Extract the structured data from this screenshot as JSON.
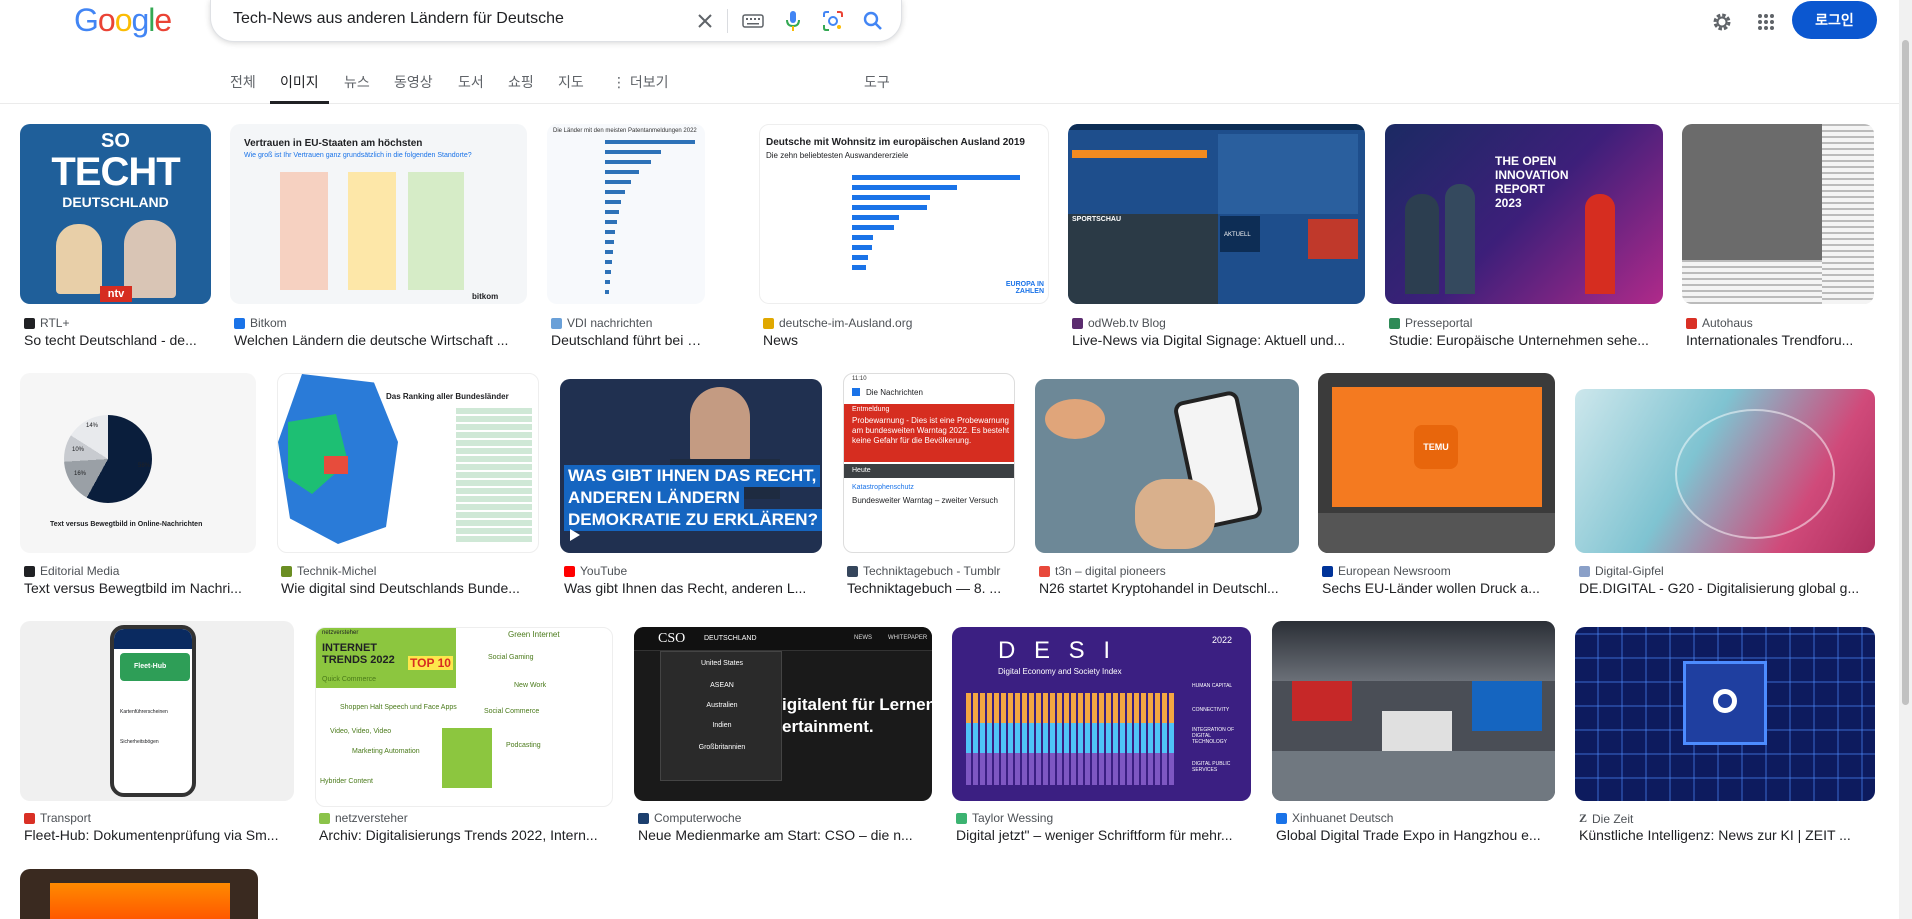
{
  "logo": {
    "letters": [
      "G",
      "o",
      "o",
      "g",
      "l",
      "e"
    ],
    "colors": [
      "#4285f4",
      "#ea4335",
      "#fbbc05",
      "#4285f4",
      "#34a853",
      "#ea4335"
    ]
  },
  "search": {
    "query": "Tech-News aus anderen Ländern für Deutsche"
  },
  "header": {
    "login_label": "로그인"
  },
  "tabs": [
    {
      "label": "전체"
    },
    {
      "label": "이미지"
    },
    {
      "label": "뉴스"
    },
    {
      "label": "동영상"
    },
    {
      "label": "도서"
    },
    {
      "label": "쇼핑"
    },
    {
      "label": "지도"
    },
    {
      "label": "⋮ 더보기"
    }
  ],
  "tools_label": "도구",
  "results": [
    {
      "source": "RTL+",
      "title": "So techt Deutschland - de...",
      "fav": "#202124",
      "thumb": {
        "bg": "#1f5f9a",
        "line1": "SO",
        "line2": "TECHT",
        "line3": "DEUTSCHLAND",
        "badge": "ntv"
      }
    },
    {
      "source": "Bitkom",
      "title": "Welchen Ländern die deutsche Wirtschaft ...",
      "fav": "#1a73e8",
      "thumb": {
        "heading": "Vertrauen in EU-Staaten am höchsten",
        "sub": "Wie groß ist Ihr Vertrauen ganz grundsätzlich in die folgenden Standorte?",
        "brand": "bitkom"
      }
    },
    {
      "source": "VDI nachrichten",
      "title": "Deutschland führt bei Pate...",
      "fav": "#6aa0d8",
      "thumb": {
        "heading": "Die Länder mit den meisten Patentanmeldungen 2022"
      }
    },
    {
      "source": "deutsche-im-Ausland.org",
      "title": "News",
      "fav": "#e0a800",
      "thumb": {
        "heading": "Deutsche mit Wohnsitz im europäischen Ausland 2019",
        "sub": "Die zehn beliebtesten Auswandererziele",
        "brand": "EUROPA IN ZAHLEN"
      }
    },
    {
      "source": "odWeb.tv Blog",
      "title": "Live-News via Digital Signage: Aktuell und...",
      "fav": "#5b2c6f",
      "thumb": {
        "label1": "SPORTSCHAU",
        "label2": "AKTUELL"
      }
    },
    {
      "source": "Presseportal",
      "title": "Studie: Europäische Unternehmen sehe...",
      "fav": "#2e8b57",
      "thumb": {
        "text": "THE OPEN INNOVATION REPORT 2023"
      }
    },
    {
      "source": "Autohaus",
      "title": "Internationales Trendforu...",
      "fav": "#d93025",
      "thumb": {}
    },
    {
      "source": "Editorial Media",
      "title": "Text versus Bewegtbild im Nachri...",
      "fav": "#202124",
      "thumb": {
        "caption": "Text versus Bewegtbild in Online-Nachrichten",
        "pcts": [
          "14%",
          "10%",
          "16%",
          "58%"
        ]
      }
    },
    {
      "source": "Technik-Michel",
      "title": "Wie digital sind Deutschlands Bunde...",
      "fav": "#6b8e23",
      "thumb": {
        "heading": "Das Ranking aller Bundesländer"
      }
    },
    {
      "source": "YouTube",
      "title": "Was gibt Ihnen das Recht, anderen L...",
      "fav": "#ff0000",
      "thumb": {
        "line1": "WAS GIBT IHNEN DAS RECHT,",
        "line2": "ANDEREN LÄNDERN",
        "line3": "DEMOKRATIE ZU ERKLÄREN?"
      }
    },
    {
      "source": "Techniktagebuch - Tumblr",
      "title": "Techniktagebuch — 8. ...",
      "fav": "#35465c",
      "thumb": {
        "status": "11:10",
        "app": "Die Nachrichten",
        "alert_head": "Entmeldung",
        "alert": "Probewarnung - Dies ist eine Probewarnung am bundesweiten Warntag 2022. Es besteht keine Gefahr für die Bevölkerung.",
        "section": "Heute",
        "category": "Katastrophenschutz",
        "headline": "Bundesweiter Warntag – zweiter Versuch"
      }
    },
    {
      "source": "t3n – digital pioneers",
      "title": "N26 startet Kryptohandel in Deutschl...",
      "fav": "#e8483b",
      "thumb": {}
    },
    {
      "source": "European Newsroom",
      "title": "Sechs EU-Länder wollen Druck a...",
      "fav": "#003399",
      "thumb": {
        "brand": "TEMU"
      }
    },
    {
      "source": "Digital-Gipfel",
      "title": "DE.DIGITAL - G20 - Digitalisierung global g...",
      "fav": "#8aa0c8",
      "thumb": {}
    },
    {
      "source": "Transport",
      "title": "Fleet-Hub: Dokumentenprüfung via Sm...",
      "fav": "#d93025",
      "thumb": {
        "app": "Fleet-Hub",
        "item1": "Kartenführerscheinen",
        "item2": "Sicherheitsbögen"
      }
    },
    {
      "source": "netzversteher",
      "title": "Archiv: Digitalisierungs Trends 2022, Intern...",
      "fav": "#8bc34a",
      "thumb": {
        "top": "netzversteher",
        "heading": "INTERNET TRENDS 2022",
        "badge": "TOP 10",
        "items": [
          "Green Internet",
          "Quick Commerce",
          "Social Gaming",
          "Shoppen Halt Speech und Face Apps",
          "New Work",
          "Video, Video, Video",
          "Social Commerce",
          "Marketing Automation",
          "Podcasting",
          "Hybrider Content"
        ]
      }
    },
    {
      "source": "Computerwoche",
      "title": "Neue Medienmarke am Start: CSO – die n...",
      "fav": "#1c3f6e",
      "thumb": {
        "brand": "CSO",
        "region": "DEUTSCHLAND",
        "nav1": "NEWS",
        "nav2": "WHITEPAPER",
        "menu": [
          "United States",
          "ASEAN",
          "Australien",
          "Indien",
          "Großbritannien"
        ],
        "big1": "igitalent für Lernen",
        "big2": "ertainment."
      }
    },
    {
      "source": "Taylor Wessing",
      "title": "Digital jetzt\" – weniger Schriftform für mehr...",
      "fav": "#3cb371",
      "thumb": {
        "heading": "D E S I",
        "sub": "Digital Economy and Society Index",
        "year": "2022",
        "legend": [
          "HUMAN CAPITAL",
          "CONNECTIVITY",
          "INTEGRATION OF DIGITAL TECHNOLOGY",
          "DIGITAL PUBLIC SERVICES"
        ]
      }
    },
    {
      "source": "Xinhuanet Deutsch",
      "title": "Global Digital Trade Expo in Hangzhou e...",
      "fav": "#1a73e8",
      "thumb": {}
    },
    {
      "source": "Die Zeit",
      "title": "Künstliche Intelligenz: News zur KI | ZEIT ...",
      "fav": "#202124",
      "thumb": {}
    }
  ]
}
